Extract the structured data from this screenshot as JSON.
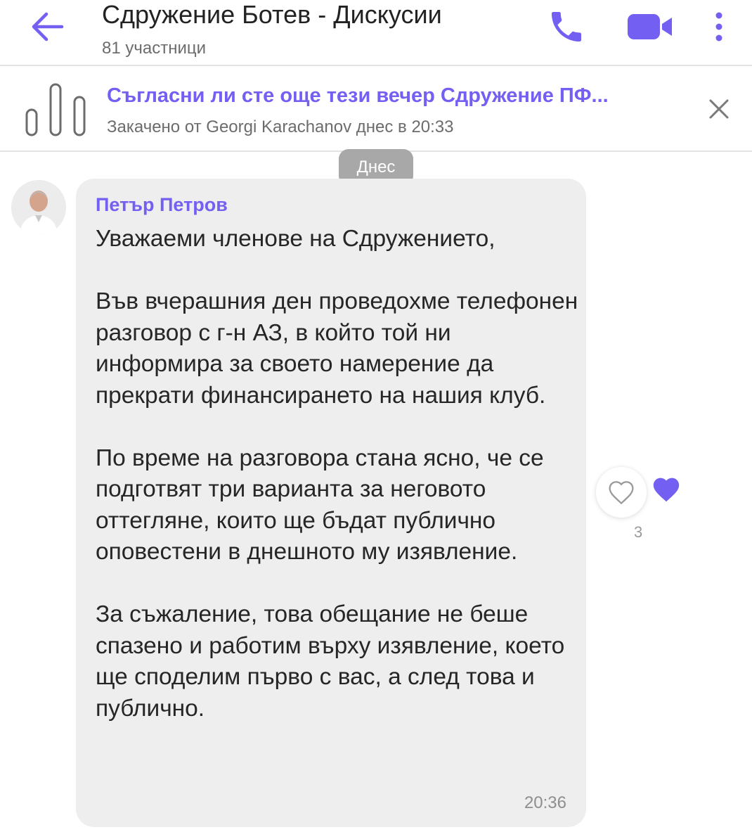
{
  "header": {
    "title": "Сдружение Ботев - Дискусии",
    "participants": "81 участници",
    "icons": {
      "back": "arrow-left-icon",
      "call": "phone-icon",
      "video": "video-camera-icon",
      "more": "more-vertical-icon"
    }
  },
  "pinned": {
    "title": "Съгласни ли сте още тези вечер Сдружение ПФ...",
    "subtitle": "Закачено от Georgi Karachanov днес в 20:33",
    "icons": {
      "poll": "poll-icon",
      "close": "close-icon"
    }
  },
  "date_chip": "Днес",
  "message": {
    "sender": "Петър Петров",
    "paragraphs": [
      "Уважаеми членове на Сдружението,",
      "Във вчерашния ден проведохме телефонен разговор с г-н АЗ, в който той ни информира за своето намерение да прекрати финансирането на нашия клуб.",
      "По време на разговора стана ясно, че се подготвят три варианта за неговото оттегляне, които ще бъдат публично оповестени в днешното му изявление.",
      "За съжаление, това обещание не беше спазено и работим върху изявление, което ще споделим първо с вас, а след това и публично."
    ],
    "time": "20:36",
    "reactions": {
      "count": "3",
      "icons": [
        "heart-outline-icon",
        "heart-filled-icon"
      ]
    }
  },
  "colors": {
    "accent": "#7360f2",
    "bubble": "#eeeeee",
    "date_chip": "#a8a8a8",
    "text": "#262626",
    "muted": "#6c6c6c"
  }
}
